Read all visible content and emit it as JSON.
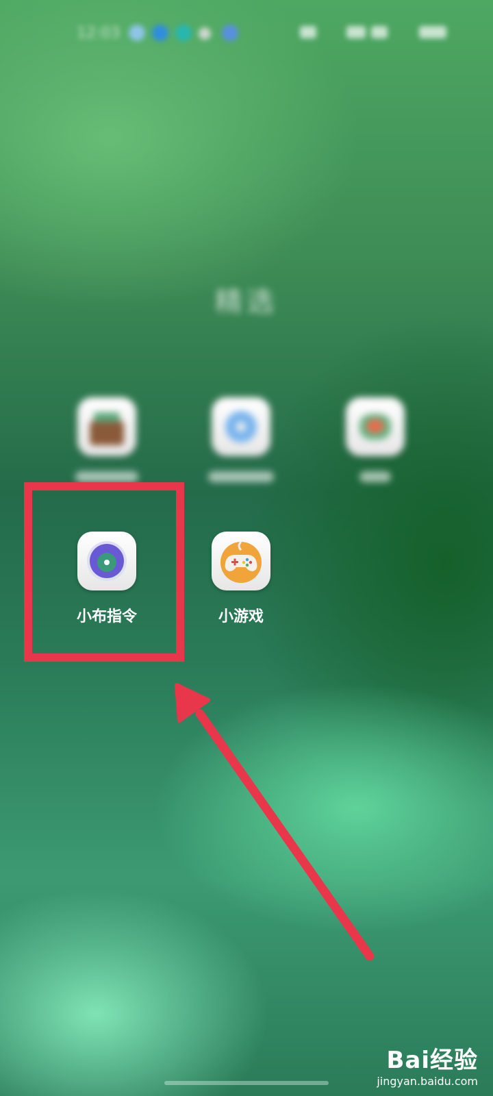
{
  "status_bar": {
    "time": "12:03"
  },
  "folder": {
    "title": "精选"
  },
  "apps": [
    {
      "label": "小布指令",
      "icon": "xiaobu-command-icon"
    },
    {
      "label": "小游戏",
      "icon": "gamepad-icon"
    }
  ],
  "annotation": {
    "box_color": "#e8364b",
    "arrow_color": "#e8364b"
  },
  "watermark": {
    "logo": "Bai经验",
    "url": "jingyan.baidu.com"
  }
}
